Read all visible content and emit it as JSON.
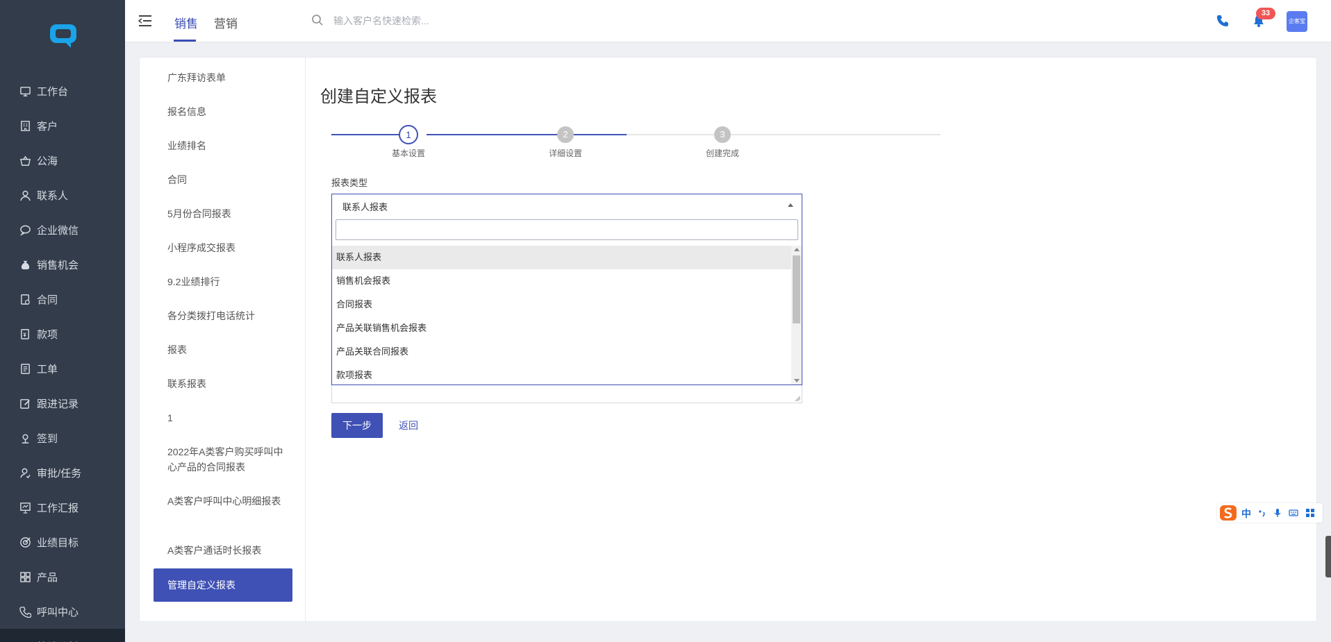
{
  "sidebar": {
    "items": [
      {
        "label": "工作台",
        "icon": "monitor-icon"
      },
      {
        "label": "客户",
        "icon": "building-icon"
      },
      {
        "label": "公海",
        "icon": "basket-icon"
      },
      {
        "label": "联系人",
        "icon": "person-icon"
      },
      {
        "label": "企业微信",
        "icon": "chat-icon"
      },
      {
        "label": "销售机会",
        "icon": "money-bag-icon"
      },
      {
        "label": "合同",
        "icon": "contract-icon"
      },
      {
        "label": "款项",
        "icon": "payment-icon"
      },
      {
        "label": "工单",
        "icon": "ticket-icon"
      },
      {
        "label": "跟进记录",
        "icon": "edit-icon"
      },
      {
        "label": "签到",
        "icon": "location-icon"
      },
      {
        "label": "审批/任务",
        "icon": "approval-icon"
      },
      {
        "label": "工作汇报",
        "icon": "report-icon"
      },
      {
        "label": "业绩目标",
        "icon": "target-icon"
      },
      {
        "label": "产品",
        "icon": "grid-icon"
      },
      {
        "label": "呼叫中心",
        "icon": "phone-icon"
      },
      {
        "label": "统计分析",
        "icon": "chart-icon"
      }
    ]
  },
  "header": {
    "tabs": [
      "销售",
      "营销"
    ],
    "search_placeholder": "输入客户名快速检索...",
    "notification_count": "33",
    "avatar_text": "企客宝"
  },
  "subnav": {
    "items": [
      "广东拜访表单",
      "报名信息",
      "业绩排名",
      "合同",
      "5月份合同报表",
      "小程序成交报表",
      "9.2业绩排行",
      "各分类拨打电话统计",
      "报表",
      "联系报表",
      "1",
      "2022年A类客户购买呼叫中心产品的合同报表",
      "A类客户呼叫中心明细报表",
      "A类客户通话时长报表"
    ],
    "active": "管理自定义报表"
  },
  "main": {
    "title": "创建自定义报表",
    "steps": [
      {
        "num": "1",
        "label": "基本设置"
      },
      {
        "num": "2",
        "label": "详细设置"
      },
      {
        "num": "3",
        "label": "创建完成"
      }
    ],
    "field_label": "报表类型",
    "select_value": "联系人报表",
    "dropdown_options": [
      "联系人报表",
      "销售机会报表",
      "合同报表",
      "产品关联销售机会报表",
      "产品关联合同报表",
      "款项报表"
    ],
    "next_button": "下一步",
    "back_link": "返回"
  },
  "ime": {
    "mode": "中"
  },
  "colors": {
    "accent": "#3f51b5",
    "sidebar_bg": "#323c4a",
    "badge": "#f05555"
  }
}
